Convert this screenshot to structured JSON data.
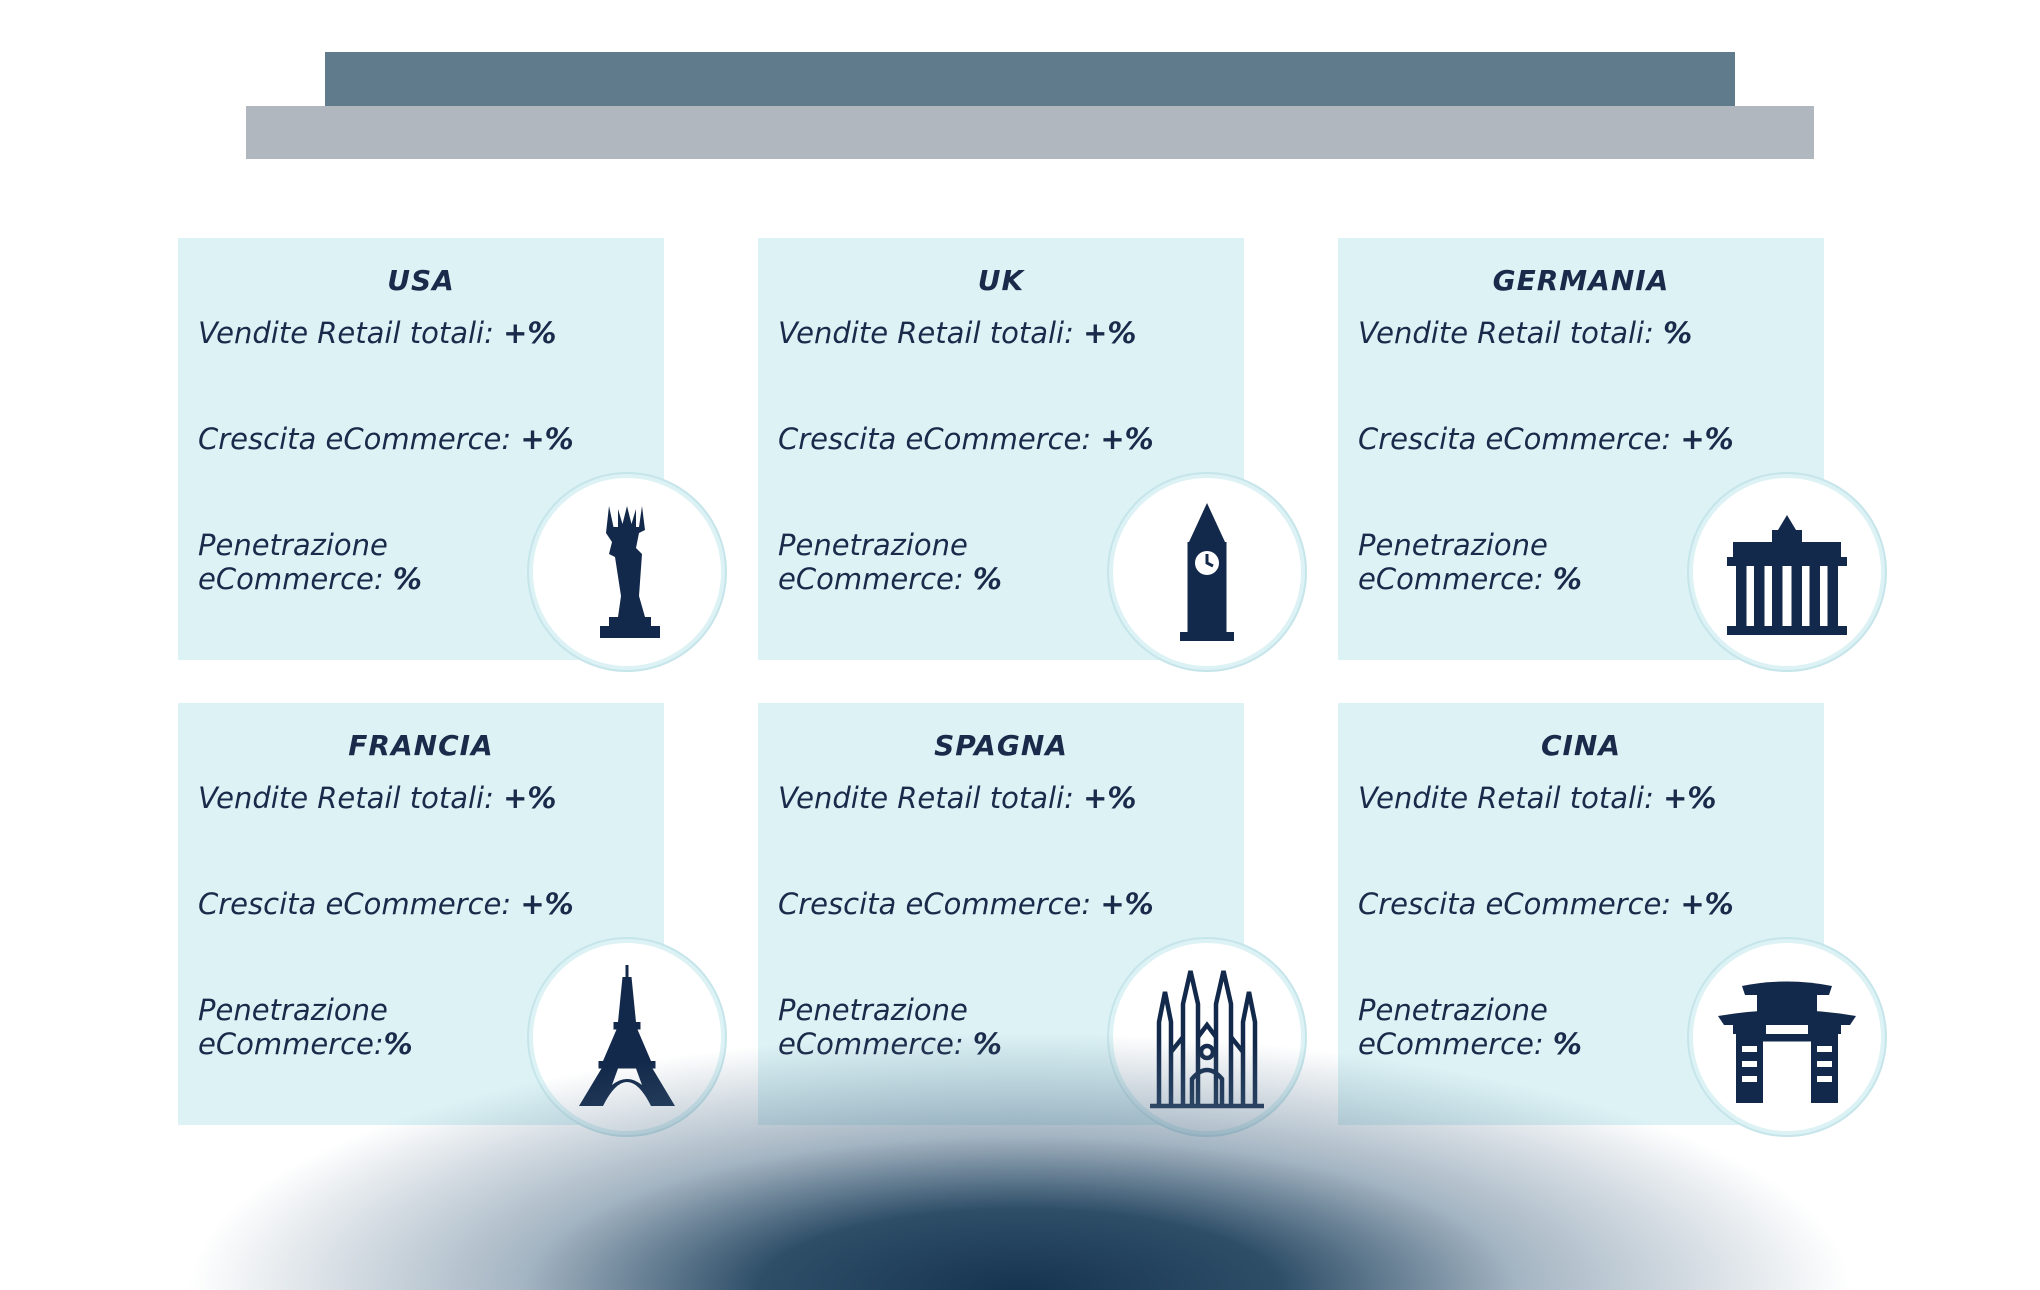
{
  "cards": [
    {
      "title": "USA",
      "retail_label": "Vendite Retail totali: ",
      "retail_value": "+%",
      "growth_label": "Crescita eCommerce: ",
      "growth_value": "+%",
      "pen_label": "Penetrazione eCommerce: ",
      "pen_value": "%",
      "icon": "statue-of-liberty-icon"
    },
    {
      "title": "UK",
      "retail_label": "Vendite Retail totali: ",
      "retail_value": "+%",
      "growth_label": "Crescita eCommerce: ",
      "growth_value": "+%",
      "pen_label": "Penetrazione eCommerce: ",
      "pen_value": "%",
      "icon": "big-ben-icon"
    },
    {
      "title": "GERMANIA",
      "retail_label": "Vendite Retail totali: ",
      "retail_value": "%",
      "growth_label": "Crescita eCommerce: ",
      "growth_value": "+%",
      "pen_label": "Penetrazione eCommerce: ",
      "pen_value": "%",
      "icon": "brandenburg-gate-icon"
    },
    {
      "title": "FRANCIA",
      "retail_label": "Vendite Retail totali: ",
      "retail_value": "+%",
      "growth_label": "Crescita eCommerce: ",
      "growth_value": "+%",
      "pen_label": "Penetrazione eCommerce:",
      "pen_value": "%",
      "icon": "eiffel-tower-icon"
    },
    {
      "title": "SPAGNA",
      "retail_label": "Vendite Retail totali: ",
      "retail_value": "+%",
      "growth_label": "Crescita eCommerce: ",
      "growth_value": "+%",
      "pen_label": "Penetrazione eCommerce: ",
      "pen_value": "%",
      "icon": "sagrada-familia-icon"
    },
    {
      "title": "CINA",
      "retail_label": "Vendite Retail totali: ",
      "retail_value": "+%",
      "growth_label": "Crescita eCommerce: ",
      "growth_value": "+%",
      "pen_label": "Penetrazione eCommerce: ",
      "pen_value": "%",
      "icon": "chinese-gate-icon"
    }
  ],
  "colors": {
    "card_bg": "#dcf2f5",
    "text": "#1a2a4a",
    "icon": "#13294b",
    "banner_top": "#5f7b8c",
    "banner_bottom": "#b0b7bf"
  }
}
